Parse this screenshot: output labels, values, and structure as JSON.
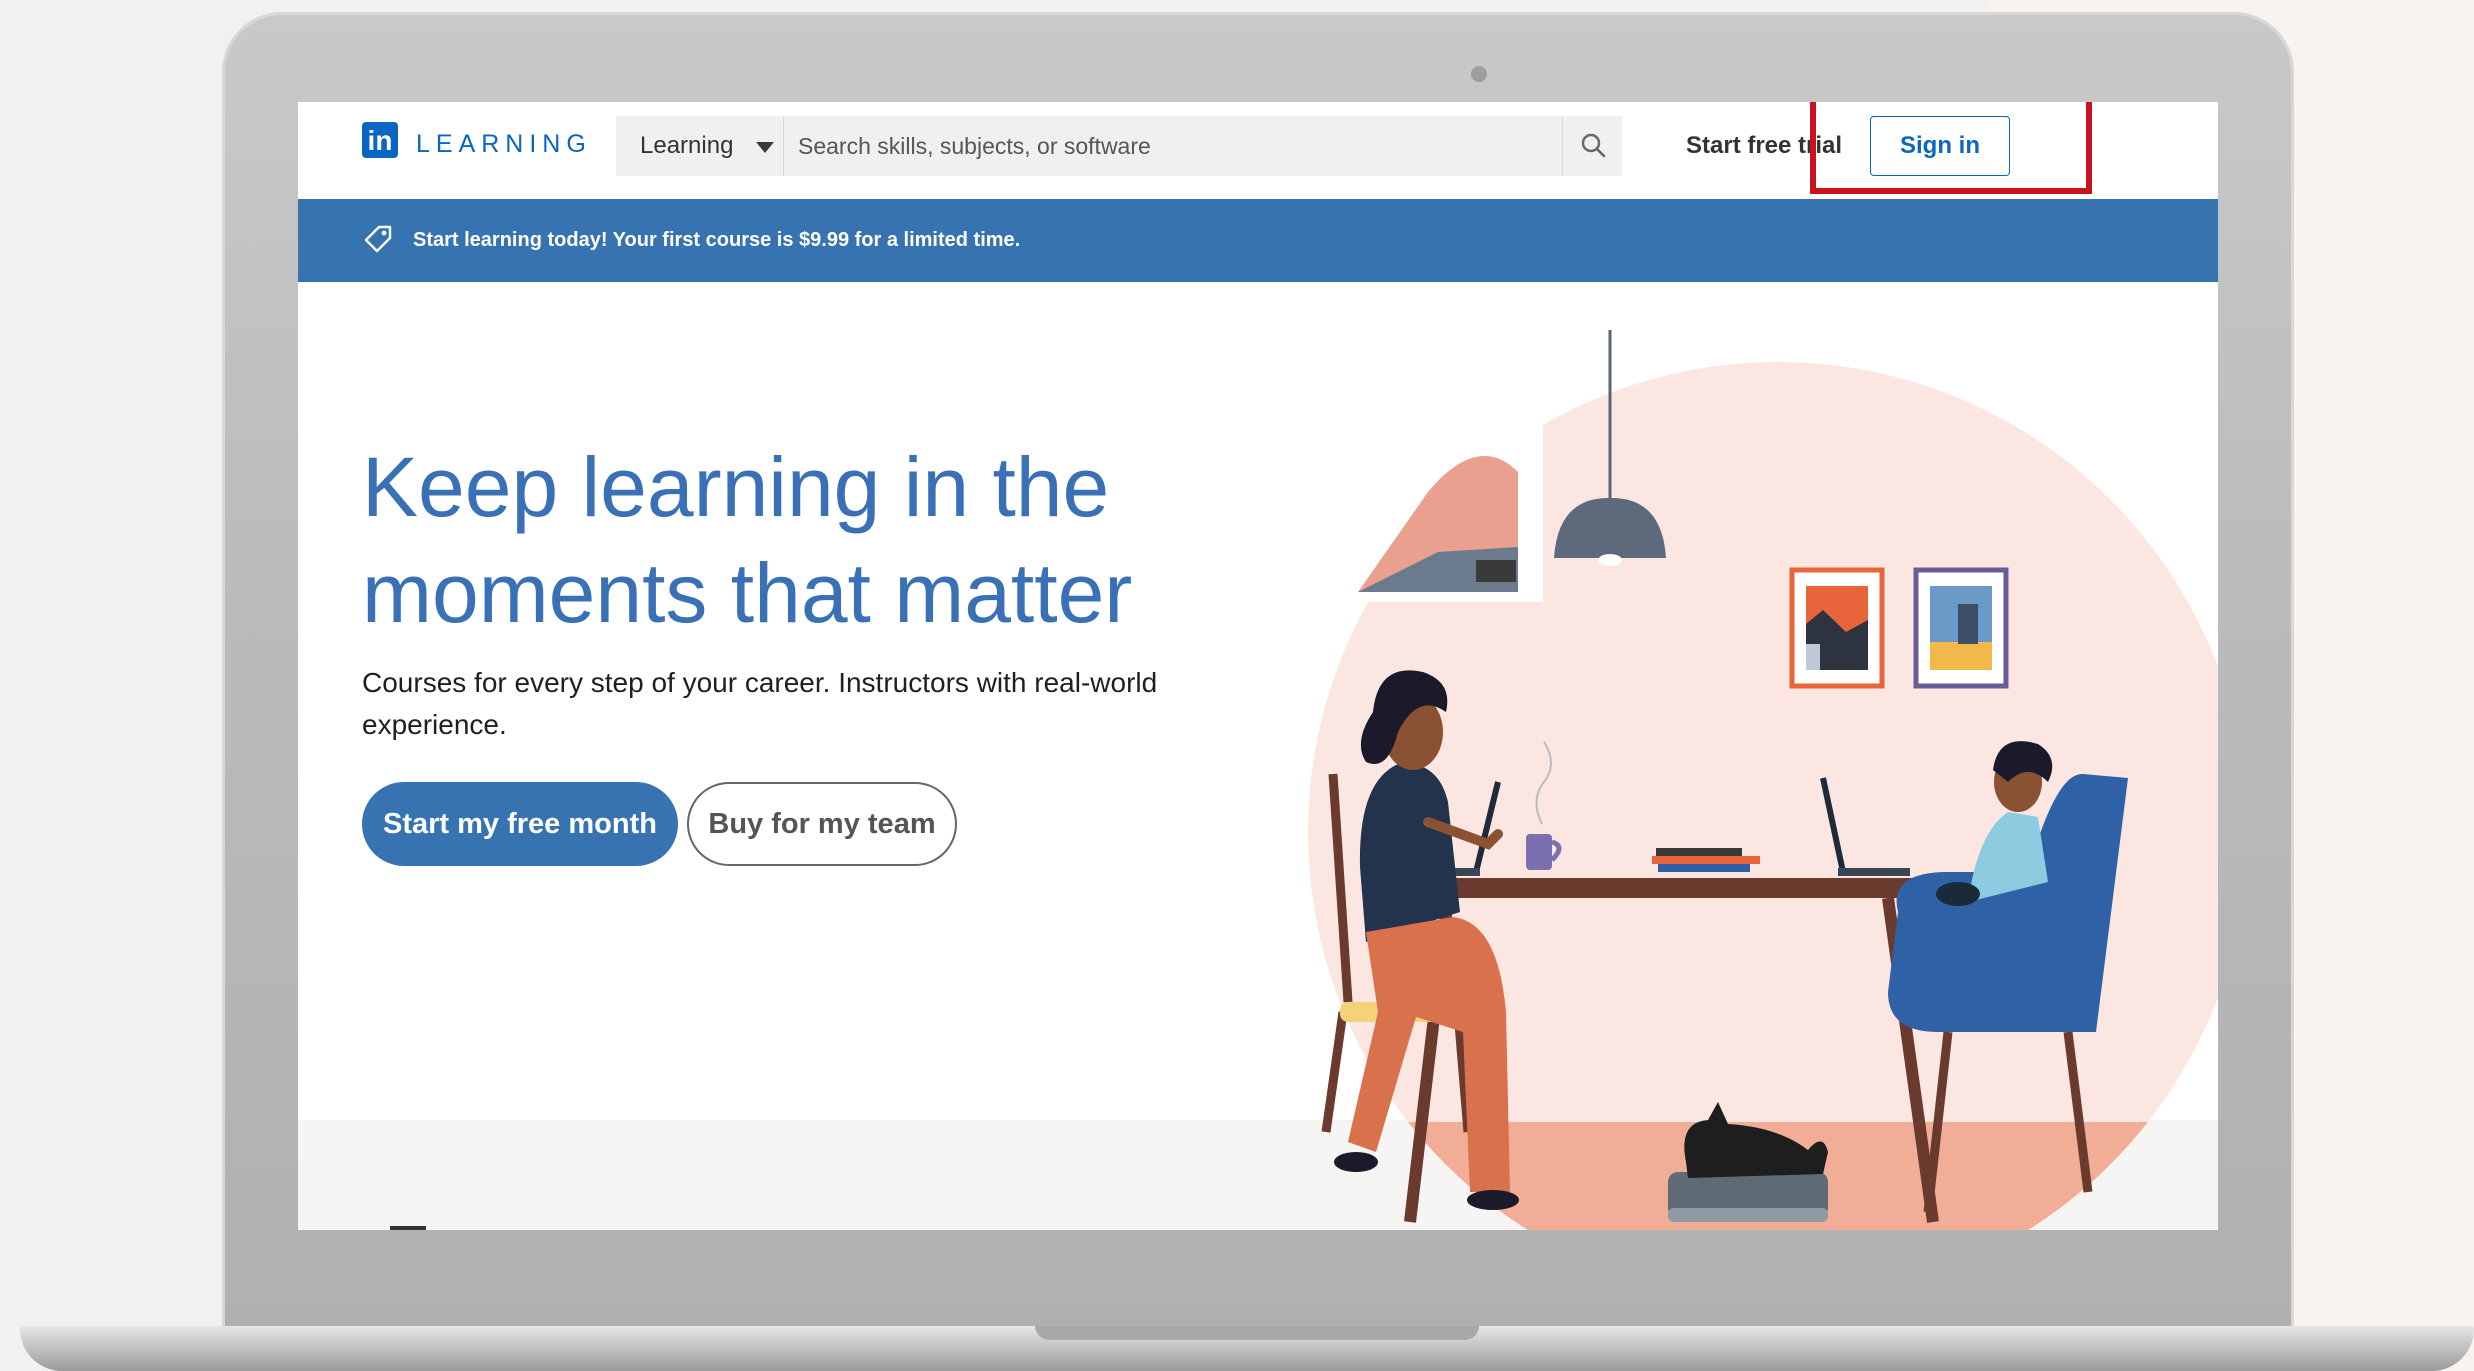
{
  "header": {
    "logo_mark": "in",
    "logo_text": "LEARNING",
    "category_label": "Learning",
    "search_placeholder": "Search skills, subjects, or software",
    "free_trial_label": "Start free trial",
    "sign_in_label": "Sign in"
  },
  "banner": {
    "text": "Start learning today! Your first course is $9.99 for a limited time."
  },
  "hero": {
    "title": "Keep learning in the moments that matter",
    "subtitle": "Courses for every step of your career. Instructors with real-world experience.",
    "primary_button": "Start my free month",
    "secondary_button": "Buy for my team"
  },
  "colors": {
    "brand_blue": "#0a66c2",
    "banner_blue": "#3873b1",
    "highlight_red": "#c8141e",
    "illustration_pink": "#fce6e2"
  },
  "icons": {
    "search": "search-icon",
    "tag": "tag-icon",
    "dropdown": "caret-down-icon"
  }
}
